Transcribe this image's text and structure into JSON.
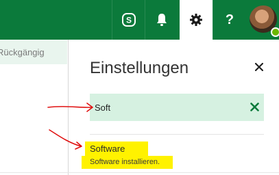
{
  "topbar": {
    "skype_icon": "skype-icon",
    "bell_icon": "bell-icon",
    "gear_icon": "gear-icon",
    "help_label": "?",
    "brand_color": "#0b7a3b"
  },
  "left": {
    "undo_label": "Rückgängig"
  },
  "settings_panel": {
    "title": "Einstellungen",
    "search": {
      "value": "Soft",
      "placeholder": ""
    },
    "results": [
      {
        "title": "Software",
        "description": "Software installieren."
      }
    ]
  },
  "annotations": {
    "arrow_color": "#e01010",
    "highlight_color": "#fff200"
  }
}
